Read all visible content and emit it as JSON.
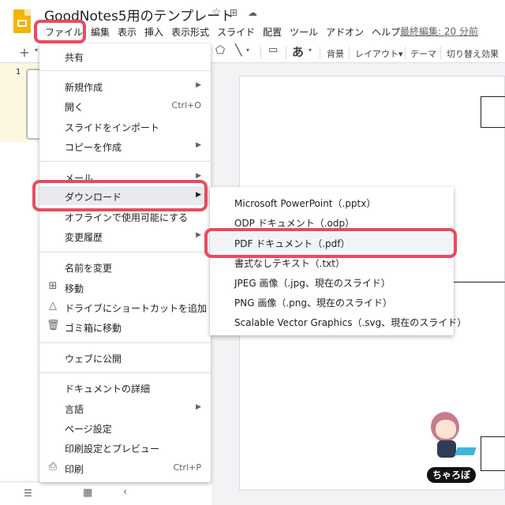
{
  "header": {
    "doc_title": "GoodNotes5用のテンプレート",
    "menus": [
      "ファイル",
      "編集",
      "表示",
      "挿入",
      "表示形式",
      "スライド",
      "配置",
      "ツール",
      "アドオン",
      "ヘルプ"
    ],
    "last_edit": "最終編集: 20 分前"
  },
  "toolbar": {
    "add": "+",
    "font_glyph": "あ",
    "background": "背景",
    "layout": "レイアウト▾",
    "theme": "テーマ",
    "transition": "切り替え効果"
  },
  "filmstrip": {
    "slide_number": "1"
  },
  "file_menu": {
    "share": "共有",
    "new": "新規作成",
    "open": "開く",
    "open_shortcut": "Ctrl+O",
    "import_slides": "スライドをインポート",
    "make_copy": "コピーを作成",
    "email": "メール",
    "download": "ダウンロード",
    "offline": "オフラインで使用可能にする",
    "version_history": "変更履歴",
    "rename": "名前を変更",
    "move": "移動",
    "add_shortcut": "ドライブにショートカットを追加",
    "trash": "ゴミ箱に移動",
    "publish": "ウェブに公開",
    "details": "ドキュメントの詳細",
    "language": "言語",
    "page_setup": "ページ設定",
    "print_preview": "印刷設定とプレビュー",
    "print": "印刷",
    "print_shortcut": "Ctrl+P"
  },
  "download_menu": [
    "Microsoft PowerPoint（.pptx）",
    "ODP ドキュメント（.odp）",
    "PDF ドキュメント（.pdf）",
    "書式なしテキスト（.txt）",
    "JPEG 画像（.jpg、現在のスライド）",
    "PNG 画像（.png、現在のスライド）",
    "Scalable Vector Graphics（.svg、現在のスライド）"
  ],
  "mascot": {
    "label": "ちゃろぼ"
  },
  "colors": {
    "highlight": "#ea4b5c",
    "logo": "#f4b400"
  }
}
